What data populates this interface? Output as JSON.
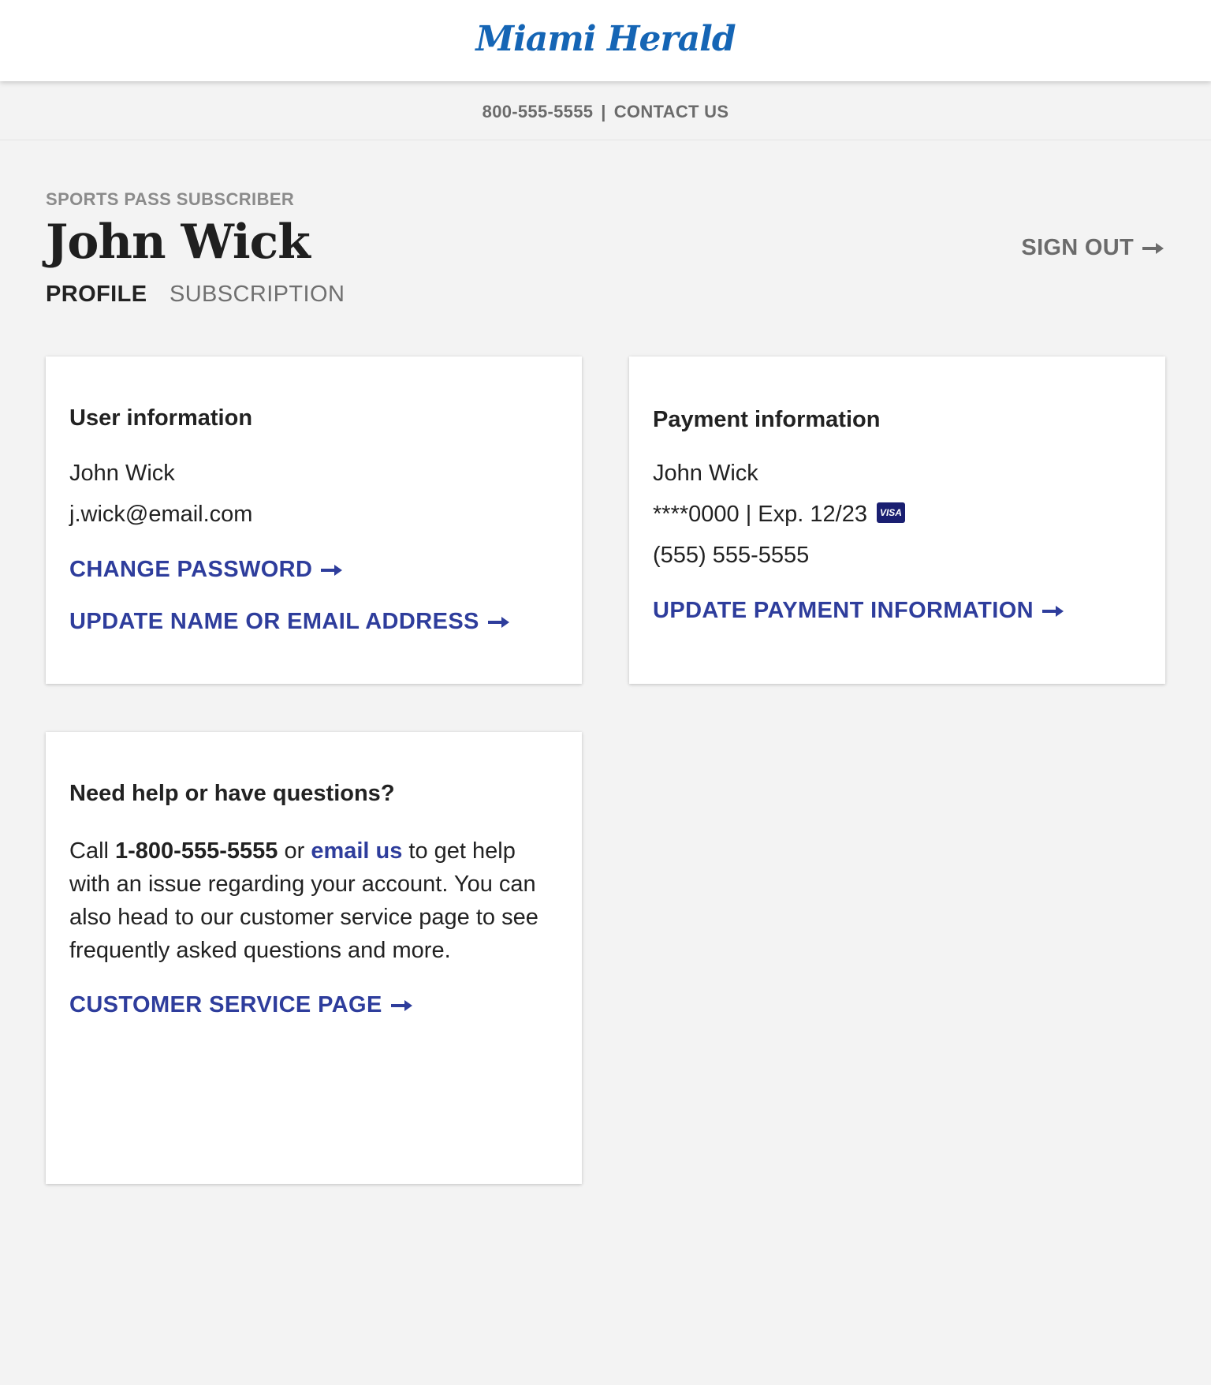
{
  "header": {
    "logo_text": "Miami Herald"
  },
  "contact_bar": {
    "phone": "800-555-5555",
    "separator": "|",
    "contact_label": "CONTACT US"
  },
  "account": {
    "subscriber_type": "SPORTS PASS SUBSCRIBER",
    "name": "John Wick",
    "sign_out_label": "SIGN OUT",
    "tabs": [
      {
        "label": "PROFILE",
        "active": true
      },
      {
        "label": "SUBSCRIPTION",
        "active": false
      }
    ]
  },
  "user_info": {
    "title": "User information",
    "name": "John Wick",
    "email": "j.wick@email.com",
    "change_password_label": "CHANGE PASSWORD",
    "update_name_email_label": "UPDATE NAME OR EMAIL ADDRESS"
  },
  "payment_info": {
    "title": "Payment information",
    "name": "John Wick",
    "card_line": "****0000 | Exp. 12/23",
    "card_brand": "VISA",
    "phone": "(555) 555-5555",
    "update_payment_label": "UPDATE PAYMENT INFORMATION"
  },
  "help": {
    "title": "Need help or have questions?",
    "text_call": "Call ",
    "phone": "1-800-555-5555",
    "text_or": " or ",
    "email_link": "email us",
    "text_rest": " to get help with an issue regarding your account. You can also head to our customer service page to see frequently asked questions and more.",
    "customer_service_label": "CUSTOMER SERVICE PAGE"
  },
  "colors": {
    "brand_blue": "#1565b5",
    "link_blue": "#2e3d9c",
    "background": "#f3f3f3",
    "visa_navy": "#1a1f71"
  }
}
